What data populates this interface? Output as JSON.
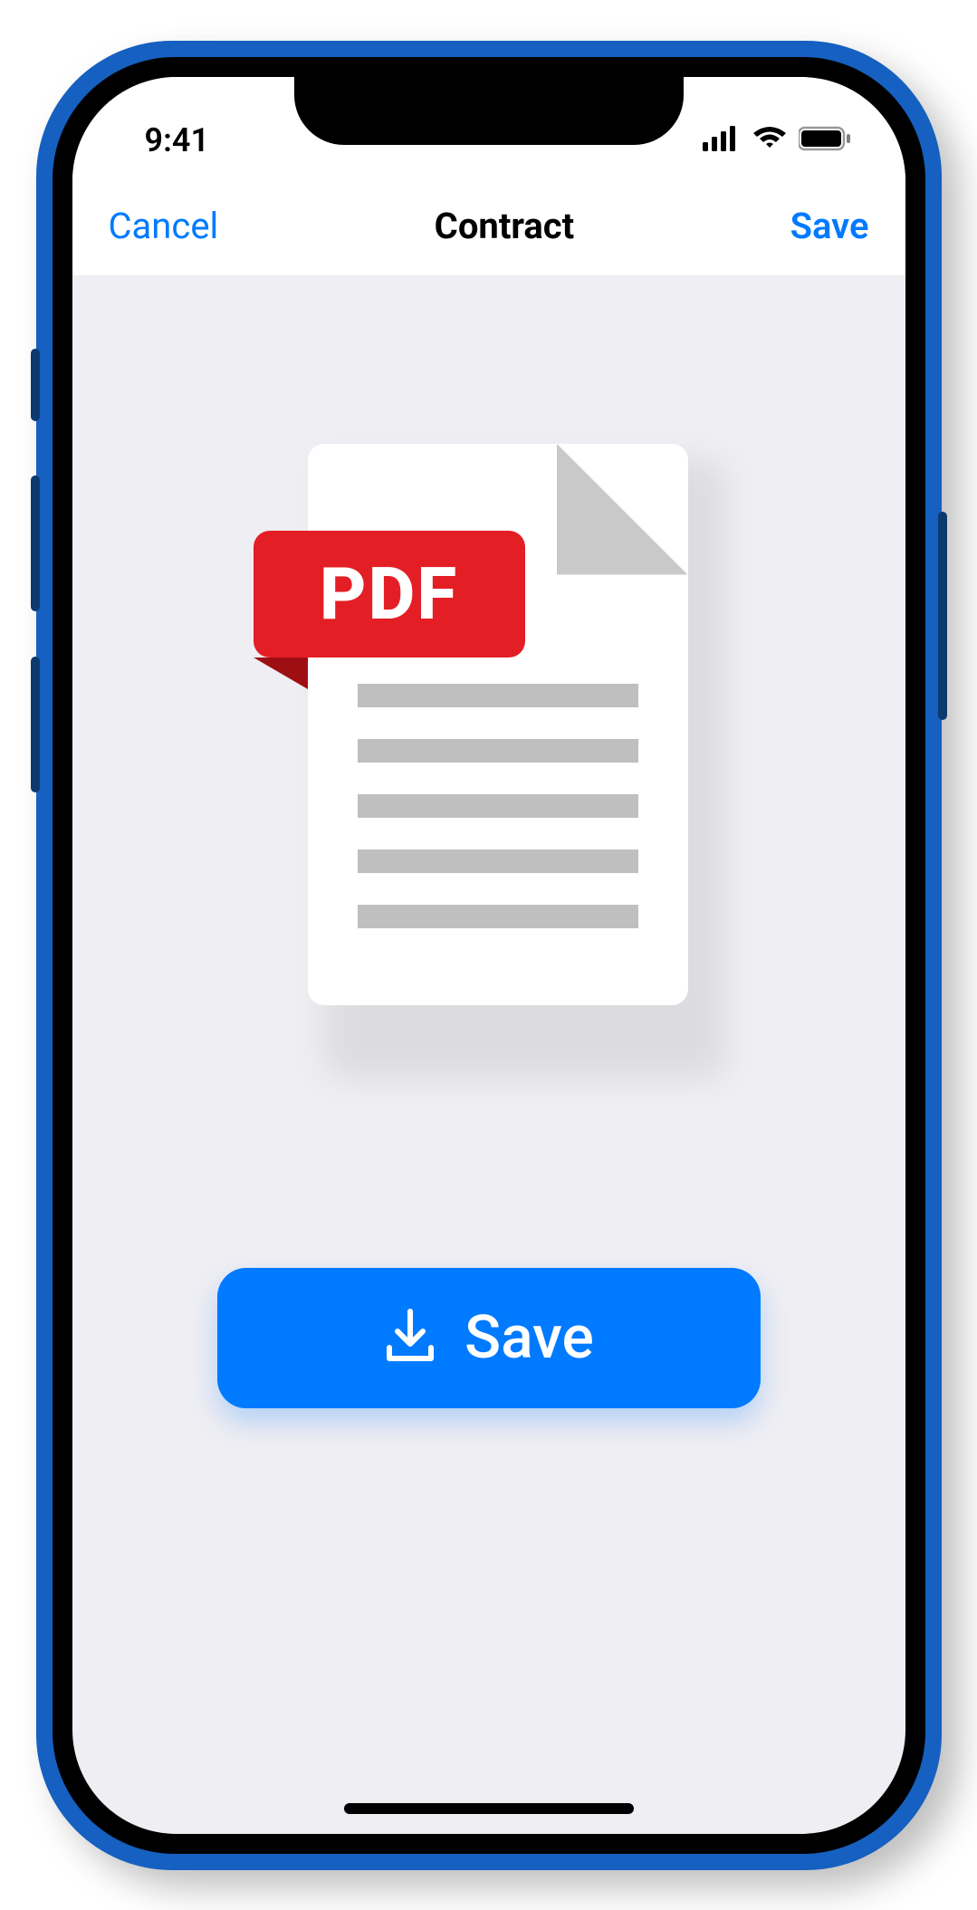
{
  "status": {
    "time": "9:41"
  },
  "nav": {
    "cancel": "Cancel",
    "title": "Contract",
    "save": "Save"
  },
  "document": {
    "badge": "PDF"
  },
  "action": {
    "save_label": "Save"
  }
}
